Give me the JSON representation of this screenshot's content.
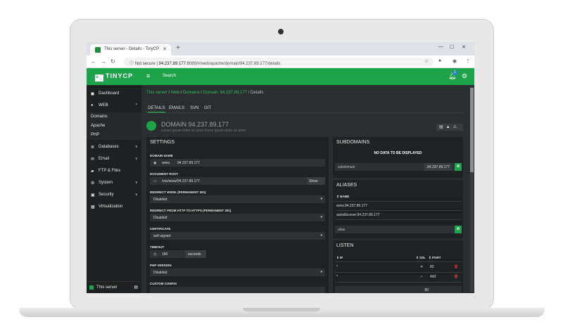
{
  "browser": {
    "tab_title": "This server - Details - TinyCP",
    "new_tab": "+",
    "url_security": "Not secure",
    "url_host": "94.237.89.177",
    "url_rest": ":8089/#/web/apache/domain/94.237.89.177/details"
  },
  "topbar": {
    "logo": "TINYCP",
    "search": "Search",
    "notif_count": "1"
  },
  "sidebar": {
    "items": [
      {
        "label": "Dashboard",
        "icon": "dashboard-icon"
      },
      {
        "label": "WEB",
        "icon": "globe-icon"
      },
      {
        "label": "Databases",
        "icon": "database-icon"
      },
      {
        "label": "Email",
        "icon": "email-icon"
      },
      {
        "label": "FTP & Files",
        "icon": "folder-icon"
      },
      {
        "label": "System",
        "icon": "gear-icon"
      },
      {
        "label": "Security",
        "icon": "lock-icon"
      },
      {
        "label": "Virtualization",
        "icon": "grid-icon"
      }
    ],
    "sub": [
      "Domains",
      "Apache",
      "PHP"
    ],
    "footer": "This server"
  },
  "breadcrumb": {
    "a": "This server",
    "b": "Web",
    "c": "Domains",
    "d": "Domain: 94.237.89.177",
    "e": "Details"
  },
  "tabs": [
    "DETAILS",
    "EMAILS",
    "SVN",
    "GIT"
  ],
  "domain": {
    "title": "DOMAIN 94.237.89.177",
    "subtitle": "Lorem ipsum dolor sit amet lorem ipsum dolor sit amet"
  },
  "settings": {
    "title": "SETTINGS",
    "domain_name_label": "DOMAIN NAME",
    "www": "www.",
    "domain_name": "94.237.89.177",
    "doc_root_label": "DOCUMENT ROOT",
    "doc_root": "/var/www/94.237.89.177",
    "show": "Show",
    "redirect_www_label": "REDIRECT WWW. (PERMANENT 301)",
    "redirect_www": "Disabled",
    "redirect_https_label": "REDIRECT FROM HTTP TO HTTPS (PERMANENT 301)",
    "redirect_https": "Disabled",
    "certificate_label": "CERTIFICATE",
    "certificate": "self-signed",
    "timeout_label": "TIMEOUT",
    "timeout": "180",
    "seconds": "seconds",
    "php_label": "PHP VERSION",
    "php": "Disabled",
    "custom_label": "CUSTOM CONFIG"
  },
  "subdomains": {
    "title": "SUBDOMAINS",
    "empty": "NO DATA TO BE DISPLAYED",
    "placeholder": "subdomain",
    "domain": ".94.237.89.177"
  },
  "aliases": {
    "title": "ALIASES",
    "col": "NAME",
    "rows": [
      "www.94.237.89.177",
      "autodiscover.94.237.89.177"
    ],
    "placeholder": "alias"
  },
  "listen": {
    "title": "LISTEN",
    "cols": {
      "ip": "IP",
      "ssl": "SSL",
      "port": "PORT"
    },
    "rows": [
      {
        "ip": "*",
        "ssl": "✕",
        "port": "80"
      },
      {
        "ip": "*",
        "ssl": "✓",
        "port": "443"
      }
    ],
    "last_value": "80"
  }
}
